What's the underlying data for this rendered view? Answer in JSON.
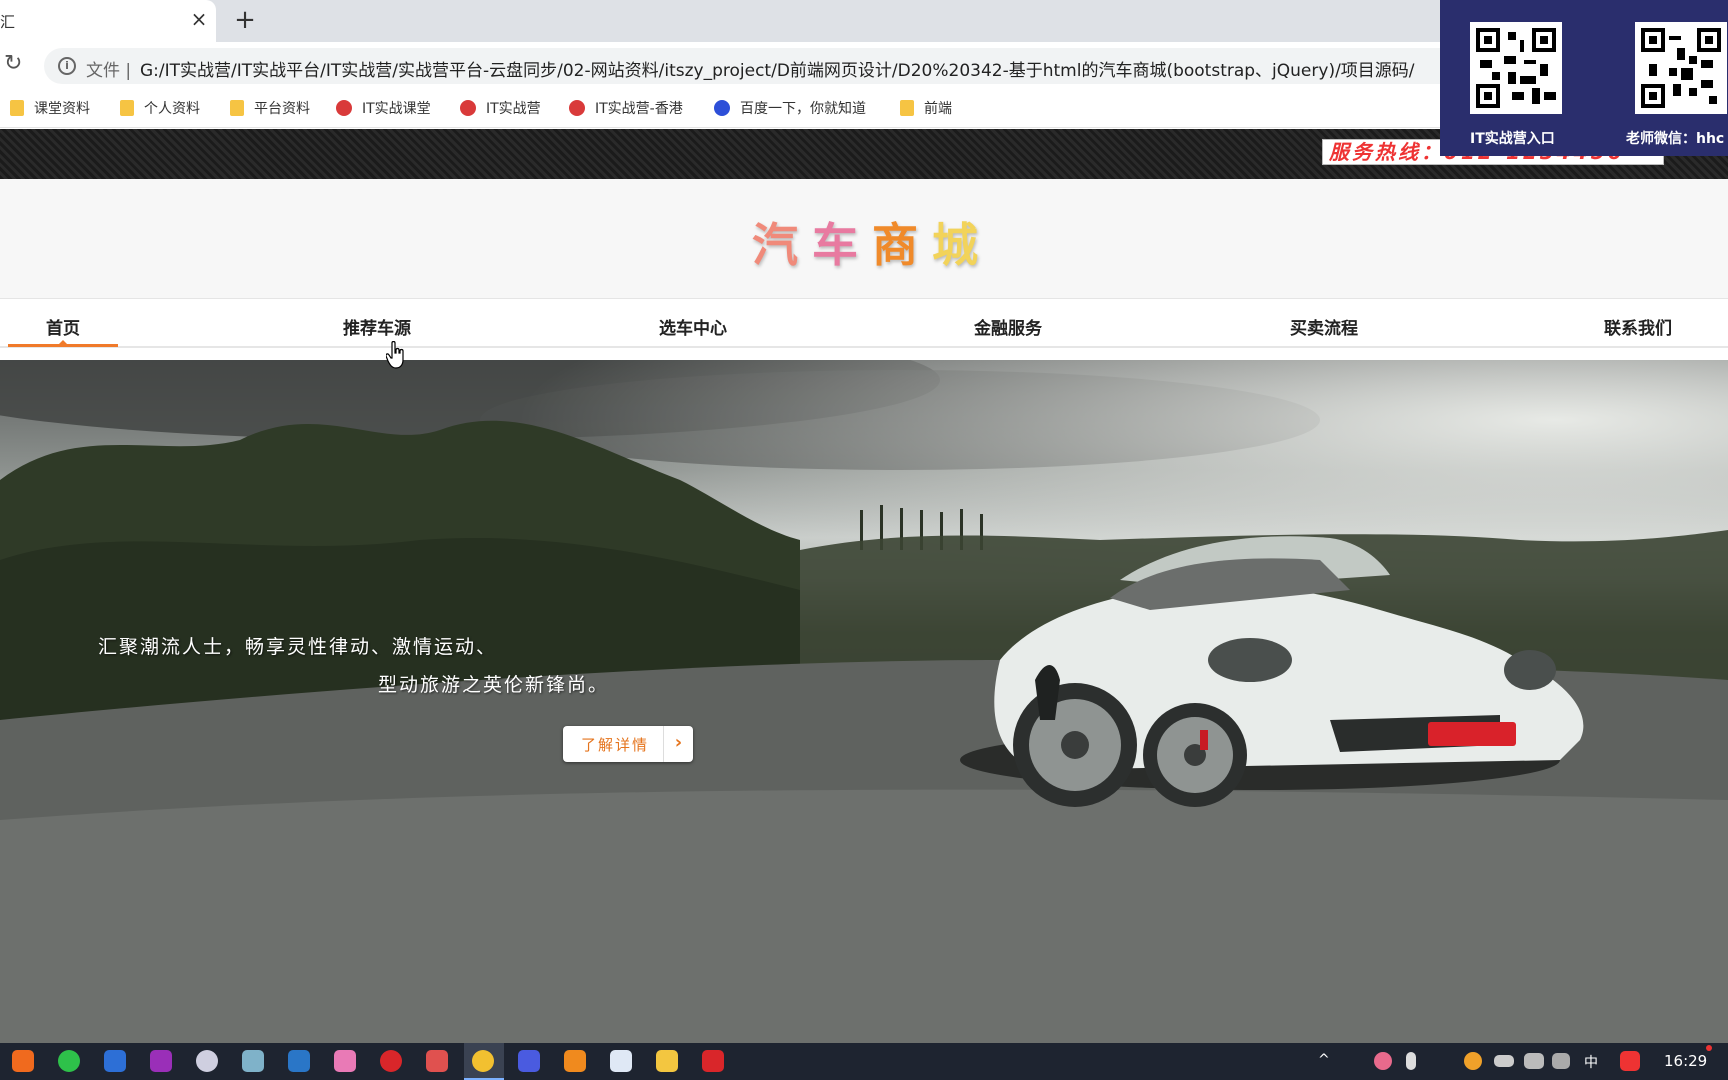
{
  "browser": {
    "tab_title": "汇",
    "close_glyph": "×",
    "newtab_glyph": "+",
    "reload_glyph": "↻",
    "scheme_label": "文件 |",
    "url": "G:/IT实战营/IT实战平台/IT实战营/实战营平台-云盘同步/02-网站资料/itszy_project/D前端网页设计/D20%20342-基于html的汽车商城(bootstrap、jQuery)/项目源码/",
    "bookmarks": [
      {
        "label": "课堂资料",
        "icon": "folder-icon"
      },
      {
        "label": "个人资料",
        "icon": "folder-icon"
      },
      {
        "label": "平台资料",
        "icon": "folder-icon"
      },
      {
        "label": "IT实战课堂",
        "icon": "site-icon"
      },
      {
        "label": "IT实战营",
        "icon": "site-icon"
      },
      {
        "label": "IT实战营-香港",
        "icon": "site-icon"
      },
      {
        "label": "百度一下，你就知道",
        "icon": "baidu-icon"
      },
      {
        "label": "前端",
        "icon": "folder-icon"
      }
    ]
  },
  "page": {
    "hotline": "服务热线：012-1234456",
    "logo_chars": [
      "汽",
      "车",
      "商",
      "城"
    ],
    "logo_colors": [
      "#f08a7a",
      "#e87aa0",
      "#f08a2a",
      "#f2d35a"
    ],
    "nav": [
      "首页",
      "推荐车源",
      "选车中心",
      "金融服务",
      "买卖流程",
      "联系我们"
    ],
    "accent": "#f07a2a",
    "hero": {
      "slogan_line1": "汇聚潮流人士，畅享灵性律动、激情运动、",
      "slogan_line2": "型动旅游之英伦新锋尚。",
      "button_label": "了解详情",
      "button_arrow": "›"
    }
  },
  "overlay": {
    "qr_left_label": "IT实战营入口",
    "qr_right_label": "老师微信：hhc"
  },
  "taskbar": {
    "tray_chevron": "^",
    "ime": "中",
    "time": "16:29"
  }
}
